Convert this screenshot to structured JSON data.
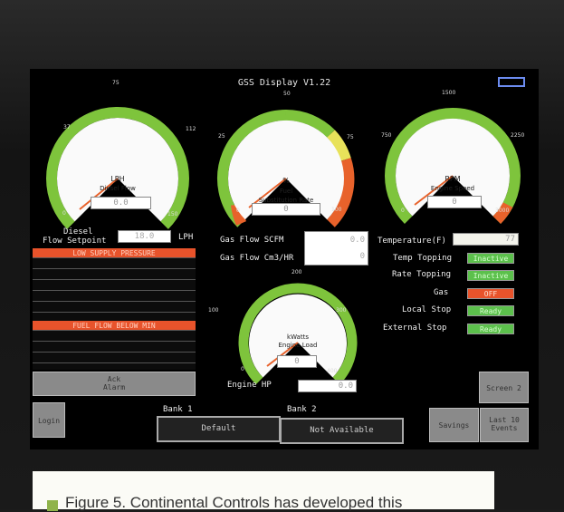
{
  "screen": {
    "title": "GSS Display V1.22"
  },
  "gauges": {
    "diesel": {
      "label1": "LPH",
      "label2": "Diesel Flow",
      "value": "0.0",
      "ticks": [
        "37",
        "75",
        "112",
        "0",
        "150"
      ]
    },
    "fuel": {
      "label1": "%",
      "label2": "Fuel",
      "label3": "Substitution Rate",
      "value": "0",
      "ticks": [
        "25",
        "50",
        "75",
        "0",
        "100"
      ]
    },
    "rpm": {
      "label1": "RPM",
      "label2": "Engine Speed",
      "value": "0",
      "ticks": [
        "750",
        "1500",
        "2250",
        "0",
        "3000"
      ]
    },
    "kw": {
      "label1": "kWatts",
      "label2": "Engine Load",
      "value": "0",
      "ticks": [
        "100",
        "200",
        "300",
        "0",
        "400"
      ]
    }
  },
  "diesel_setpoint": {
    "label1": "Diesel",
    "label2": "Flow Setpoint",
    "value": "18.0",
    "unit": "LPH"
  },
  "alarms": {
    "rows": [
      "LOW SUPPLY PRESSURE",
      "",
      "",
      "",
      "",
      "",
      "FUEL FLOW BELOW MIN",
      "",
      "",
      ""
    ],
    "ack_label1": "Ack",
    "ack_label2": "Alarm"
  },
  "gas": {
    "flow_scfm_label": "Gas Flow SCFM",
    "flow_scfm_value": "0.0",
    "flow_cm3_label": "Gas Flow Cm3/HR",
    "flow_cm3_value": "0"
  },
  "engine_hp": {
    "label": "Engine HP",
    "value": "0.0"
  },
  "status": {
    "temperature_label": "Temperature(F)",
    "temperature_value": "77",
    "items": [
      {
        "label": "Temp Topping",
        "value": "Inactive",
        "color": "#5cc04c"
      },
      {
        "label": "Rate Topping",
        "value": "Inactive",
        "color": "#5cc04c"
      },
      {
        "label": "Gas",
        "value": "OFF",
        "color": "#e8532b"
      },
      {
        "label": "Local Stop",
        "value": "Ready",
        "color": "#5cc04c"
      },
      {
        "label": "External Stop",
        "value": "Ready",
        "color": "#5cc04c"
      }
    ]
  },
  "buttons": {
    "login": "Login",
    "screen2": "Screen 2",
    "savings": "Savings",
    "last10_1": "Last 10",
    "last10_2": "Events"
  },
  "banks": {
    "bank1_label": "Bank 1",
    "bank1_value": "Default",
    "bank2_label": "Bank 2",
    "bank2_value": "Not Available"
  },
  "caption": {
    "text": "Figure 5. Continental Controls has developed this"
  },
  "colors": {
    "gauge_green": "#7ec43c",
    "gauge_yellow": "#e8e25a",
    "gauge_red": "#e8622b",
    "alarm_red": "#e8532b",
    "status_green": "#5cc04c"
  }
}
